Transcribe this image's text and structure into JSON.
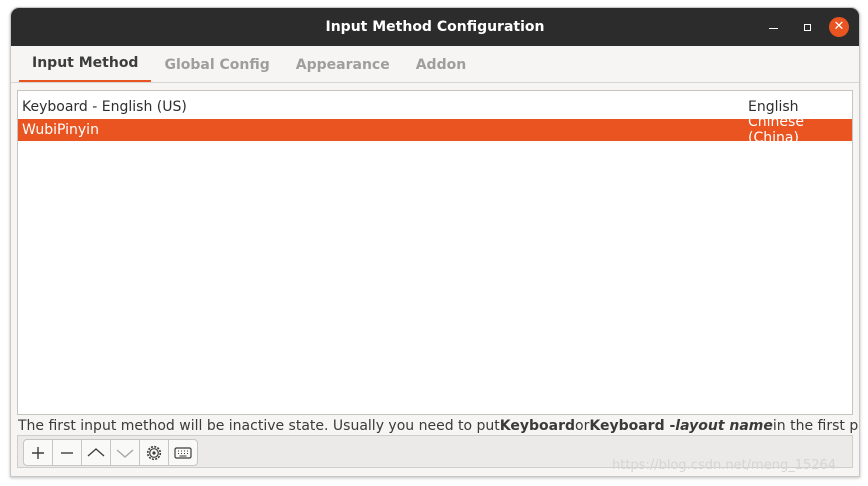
{
  "window": {
    "title": "Input Method Configuration"
  },
  "tabs": [
    {
      "label": "Input Method",
      "active": true
    },
    {
      "label": "Global Config",
      "active": false
    },
    {
      "label": "Appearance",
      "active": false
    },
    {
      "label": "Addon",
      "active": false
    }
  ],
  "input_methods": [
    {
      "name": "Keyboard - English (US)",
      "language": "English",
      "selected": false
    },
    {
      "name": "WubiPinyin",
      "language": "Chinese (China)",
      "selected": true
    }
  ],
  "hint": {
    "icon": "star-icon",
    "prefix": "The first input method will be inactive state. Usually you need to put ",
    "kw1": "Keyboard",
    "mid": " or ",
    "kw2": "Keyboard - ",
    "kw2_italic": "layout name",
    "suffix": " in the first place."
  },
  "toolbar": {
    "buttons": [
      "plus-icon",
      "minus-icon",
      "arrow-up-icon",
      "arrow-down-icon",
      "gear-icon",
      "keyboard-icon"
    ]
  },
  "watermark": "https://blog.csdn.net/meng_15264",
  "colors": {
    "accent": "#e95420",
    "titlebar": "#2c2c2c"
  }
}
